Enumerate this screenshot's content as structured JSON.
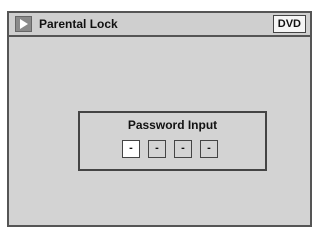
{
  "title_bar": {
    "icon": "play-icon",
    "title": "Parental Lock",
    "badge": "DVD"
  },
  "password_dialog": {
    "label": "Password Input",
    "digits": [
      "-",
      "-",
      "-",
      "-"
    ],
    "active_digit_index": 0
  },
  "colors": {
    "screen_bg": "#d3d3d3",
    "border": "#555555",
    "icon_bg": "#8a8a8a",
    "active_digit_bg": "#ffffff"
  }
}
